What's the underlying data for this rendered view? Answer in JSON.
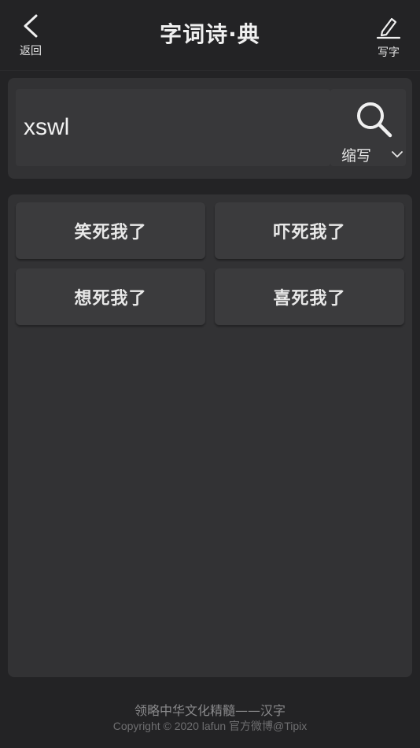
{
  "header": {
    "back_label": "返回",
    "title": "字词诗·典",
    "write_label": "写字"
  },
  "search": {
    "query": "xswl",
    "mode_label": "缩写"
  },
  "results": [
    {
      "text": "笑死我了"
    },
    {
      "text": "吓死我了"
    },
    {
      "text": "想死我了"
    },
    {
      "text": "喜死我了"
    }
  ],
  "footer": {
    "slogan": "领略中华文化精髓——汉字",
    "copyright": "Copyright © 2020  lafun 官方微博@Tipix"
  },
  "icons": {
    "back": "chevron-left-icon",
    "write": "pencil-icon",
    "search": "magnifier-icon",
    "dropdown": "chevron-down-icon"
  },
  "colors": {
    "background": "#232325",
    "panel": "#323234",
    "card": "#3b3b3d",
    "text": "#e6e6e6"
  }
}
